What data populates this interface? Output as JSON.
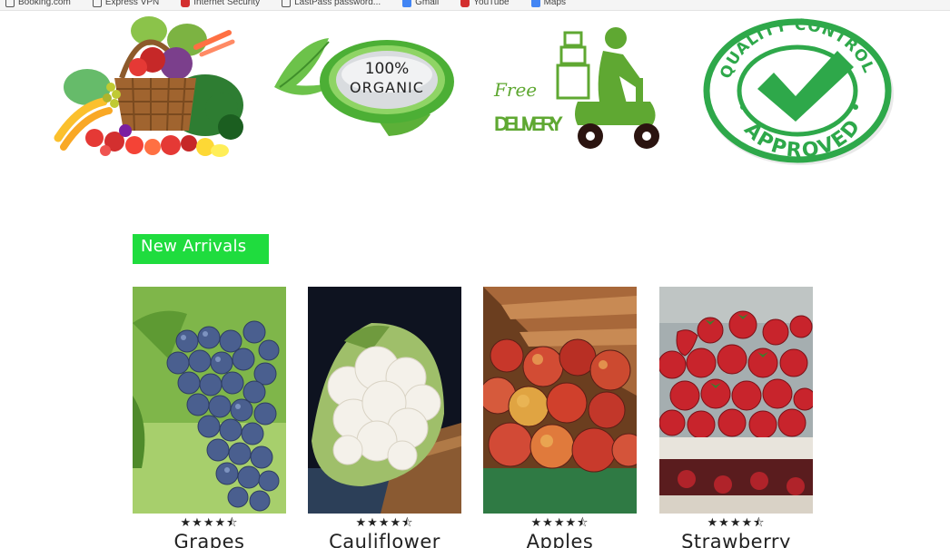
{
  "bookmarks": [
    {
      "label": "Booking.com",
      "icon": "page-icon"
    },
    {
      "label": "Express VPN",
      "icon": "page-icon"
    },
    {
      "label": "Internet Security",
      "icon": "shield-icon"
    },
    {
      "label": "LastPass password...",
      "icon": "page-icon"
    },
    {
      "label": "Gmail",
      "icon": "google-icon"
    },
    {
      "label": "YouTube",
      "icon": "youtube-icon"
    },
    {
      "label": "Maps",
      "icon": "maps-icon"
    }
  ],
  "features": {
    "organic_badge_line1": "100%",
    "organic_badge_line2": "ORGANIC",
    "delivery_line1": "Free",
    "delivery_line2": "DELIVERY",
    "quality_top": "QUALITY CONTROL",
    "quality_bottom": "APPROVED"
  },
  "new_arrivals": {
    "title": "New Arrivals",
    "products": [
      {
        "name": "Grapes",
        "rating": 4.5
      },
      {
        "name": "Cauliflower",
        "rating": 4.5
      },
      {
        "name": "Apples",
        "rating": 4.5
      },
      {
        "name": "Strawberry",
        "rating": 4.5
      }
    ]
  },
  "colors": {
    "brand_green": "#1fdc3e",
    "icon_green": "#2e9f2a",
    "star": "#222222"
  }
}
